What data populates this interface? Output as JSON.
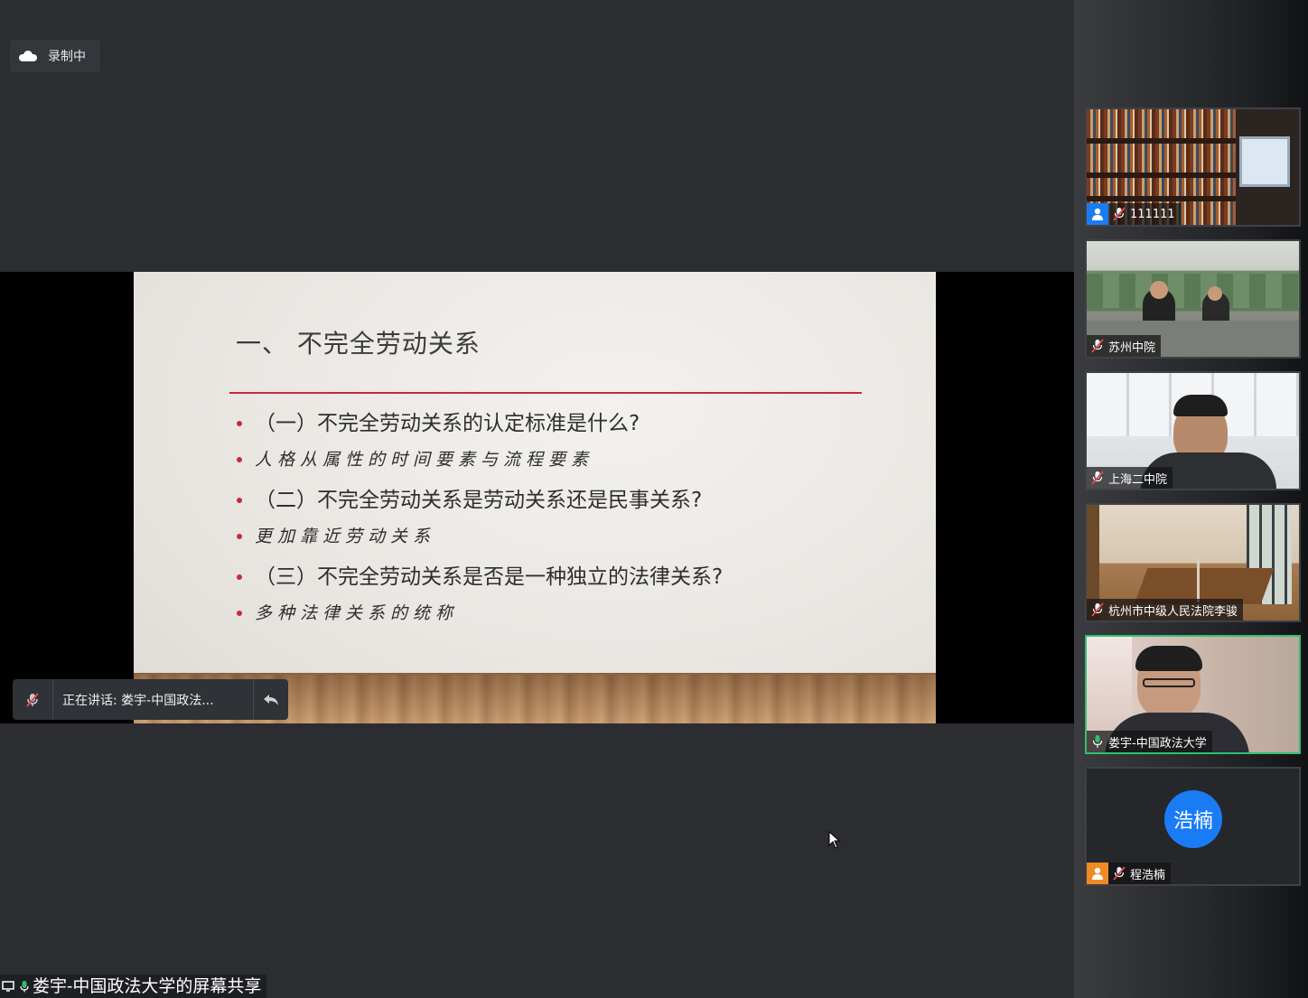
{
  "recording": {
    "label": "录制中",
    "icon": "cloud-icon"
  },
  "slide": {
    "title": "一、 不完全劳动关系",
    "bullets": [
      {
        "text": "（一）不完全劳动关系的认定标准是什么?",
        "kind": "question"
      },
      {
        "text": "人格从属性的时间要素与流程要素",
        "kind": "answer"
      },
      {
        "text": "（二）不完全劳动关系是劳动关系还是民事关系?",
        "kind": "question"
      },
      {
        "text": "更加靠近劳动关系",
        "kind": "answer"
      },
      {
        "text": "（三）不完全劳动关系是否是一种独立的法律关系?",
        "kind": "question"
      },
      {
        "text": "多种法律关系的统称",
        "kind": "answer"
      }
    ],
    "accent_color": "#c8283c"
  },
  "speaking": {
    "label": "正在讲话: 娄宇-中国政法...",
    "mic_icon": "mic-muted-icon",
    "back_icon": "reply-arrow-icon"
  },
  "footer": {
    "label": "娄宇-中国政法大学的屏幕共享"
  },
  "participants": [
    {
      "name": "111111",
      "mic": "muted",
      "avatar_icon": "user-icon",
      "scene": "bookshelf"
    },
    {
      "name": "苏州中院",
      "mic": "muted",
      "scene": "court-hall"
    },
    {
      "name": "上海二中院",
      "mic": "muted",
      "scene": "office-ceiling"
    },
    {
      "name": "杭州市中级人民法院李骏",
      "mic": "muted",
      "scene": "meeting-room"
    },
    {
      "name": "娄宇-中国政法大学",
      "mic": "active",
      "scene": "speaker",
      "active": true
    },
    {
      "name": "程浩楠",
      "mic": "muted",
      "avatar_icon": "user-icon",
      "initials": "浩楠",
      "scene": "no-video"
    }
  ],
  "colors": {
    "active_border": "#2fbf71",
    "avatar_blue": "#1a7cf5",
    "avatar_orange": "#f08a24"
  }
}
